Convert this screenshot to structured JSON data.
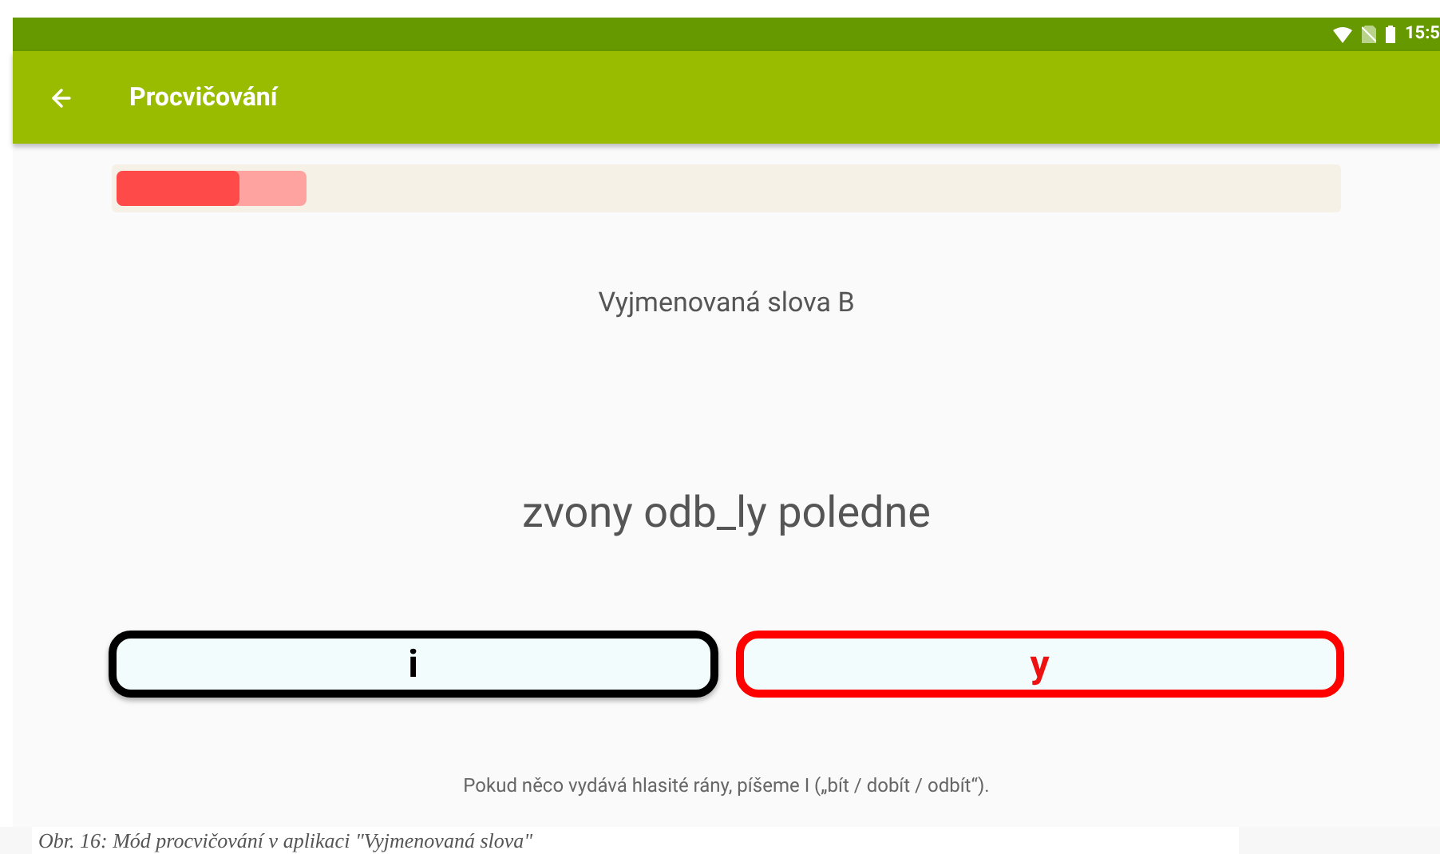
{
  "status_bar": {
    "time": "15:5"
  },
  "toolbar": {
    "title": "Procvičování"
  },
  "progress": {
    "segments": [
      {
        "level": 0.155,
        "color": "#ffa3a0"
      },
      {
        "level": 0.1,
        "color": "#ff4a4a"
      }
    ]
  },
  "category": "Vyjmenovaná slova B",
  "question": "zvony odb_ly poledne",
  "answers": [
    {
      "label": "i",
      "selected": false
    },
    {
      "label": "y",
      "selected": true
    }
  ],
  "hint": "Pokud něco vydává hlasité rány, píšeme I („bít / dobít / odbít“).",
  "caption": "Obr. 16: Mód procvičování v aplikaci \"Vyjmenovaná slova\""
}
